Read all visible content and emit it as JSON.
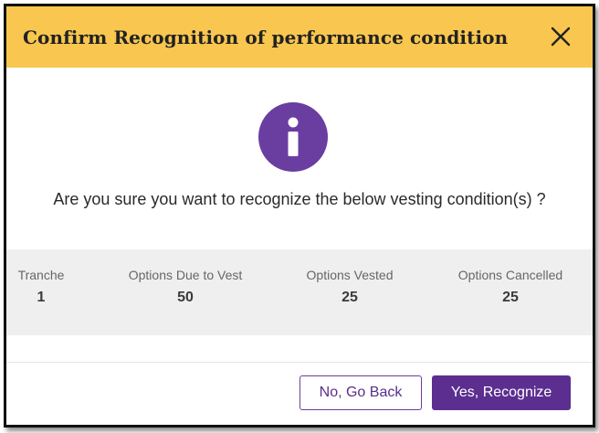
{
  "dialog": {
    "title": "Confirm Recognition of performance condition",
    "close_icon": "close-icon",
    "info_icon": "info-icon",
    "question": "Are you sure you want to recognize the below vesting condition(s) ?",
    "columns": [
      {
        "header": "Tranche",
        "value": "1"
      },
      {
        "header": "Options Due to Vest",
        "value": "50"
      },
      {
        "header": "Options Vested",
        "value": "25"
      },
      {
        "header": "Options Cancelled",
        "value": "25"
      }
    ],
    "buttons": {
      "back_label": "No, Go Back",
      "confirm_label": "Yes, Recognize"
    }
  },
  "colors": {
    "header_bg": "#f9c74f",
    "accent_purple": "#5b2e8f",
    "table_bg": "#efefef"
  }
}
